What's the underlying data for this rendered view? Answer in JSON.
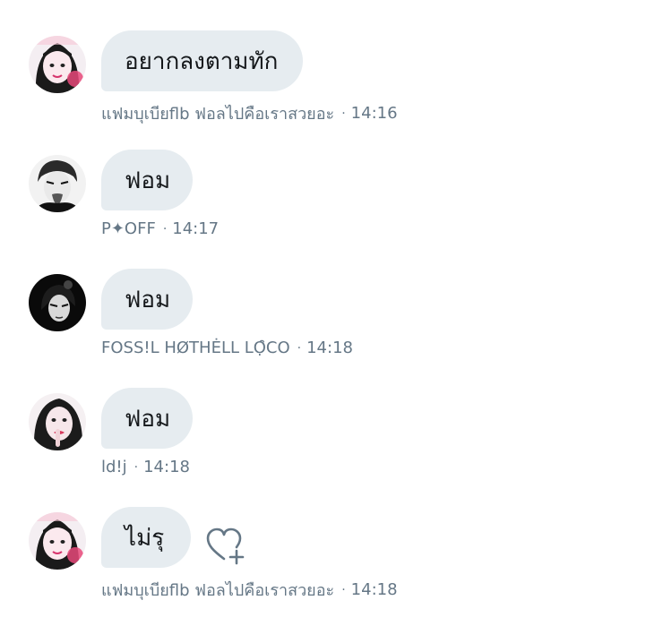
{
  "conversation": {
    "messages": [
      {
        "text": "อยากลงตามทัก",
        "sender": "แฟมบุเบียflb ฟอลไปคือเราสวยอะ",
        "time": "14:16",
        "avatar": "avatar-pink-girl"
      },
      {
        "text": "ฟอม",
        "sender": "P✦OFF",
        "time": "14:17",
        "avatar": "avatar-tongue-boy"
      },
      {
        "text": "ฟอม",
        "sender": "FOSS!L HØTHĖLL LỌ̑CO",
        "time": "14:18",
        "avatar": "avatar-dark-portrait"
      },
      {
        "text": "ฟอม",
        "sender": "ld!j",
        "time": "14:18",
        "avatar": "avatar-finger-lips"
      },
      {
        "text": "ไม่รุ",
        "sender": "แฟมบุเบียflb ฟอลไปคือเราสวยอะ",
        "time": "14:18",
        "avatar": "avatar-pink-girl",
        "reaction_icon": "heart-add-icon"
      }
    ],
    "meta_separator": "·"
  }
}
